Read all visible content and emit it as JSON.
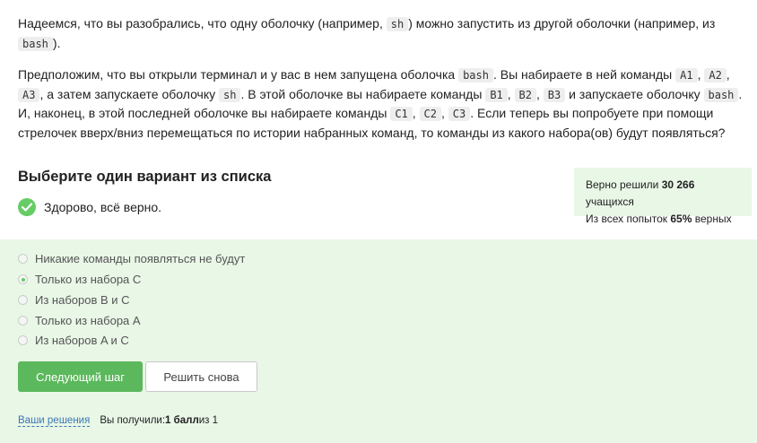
{
  "question": {
    "p1": [
      "Надеемся, что вы разобрались, что одну оболочку (например, ",
      "sh",
      ") можно запустить из другой оболочки (например, из ",
      "bash",
      ")."
    ],
    "p2": [
      "Предположим, что вы открыли терминал и у вас в нем запущена оболочка ",
      "bash",
      ". Вы набираете в ней команды ",
      "A1",
      ", ",
      "A2",
      ", ",
      "A3",
      ", а затем запускаете оболочку ",
      "sh",
      ". В этой оболочке вы набираете команды ",
      "B1",
      ", ",
      "B2",
      ", ",
      "B3",
      " и запускаете оболочку ",
      "bash",
      ". И, наконец, в этой последней оболочке вы набираете команды ",
      "C1",
      ", ",
      "C2",
      ", ",
      "C3",
      ". Если теперь вы попробуете при помощи стрелочек вверх/вниз перемещаться по истории набранных команд, то команды из какого набора(ов) будут появляться?"
    ]
  },
  "task": {
    "header": "Выберите один вариант из списка",
    "status": "Здорово, всё верно."
  },
  "stats": {
    "solved_prefix": "Верно решили ",
    "solved_count": "30 266",
    "solved_suffix": " учащихся",
    "attempts_prefix": "Из всех попыток ",
    "attempts_percent": "65%",
    "attempts_suffix": " верных"
  },
  "options": [
    {
      "label": "Никакие команды появляться не будут",
      "checked": false
    },
    {
      "label": "Только из набора C",
      "checked": true
    },
    {
      "label": "Из наборов B и C",
      "checked": false
    },
    {
      "label": "Только из набора A",
      "checked": false
    },
    {
      "label": "Из наборов A и C",
      "checked": false
    }
  ],
  "buttons": {
    "next": "Следующий шаг",
    "retry": "Решить снова"
  },
  "footer": {
    "solutions_link": "Ваши решения",
    "score_prefix": "Вы получили: ",
    "score_value": "1 балл",
    "score_suffix": " из 1"
  },
  "colors": {
    "accent": "#5cb85c",
    "success_bg": "#e9f7e7",
    "link": "#3a77b5"
  },
  "icons": {
    "status": "check-icon"
  }
}
